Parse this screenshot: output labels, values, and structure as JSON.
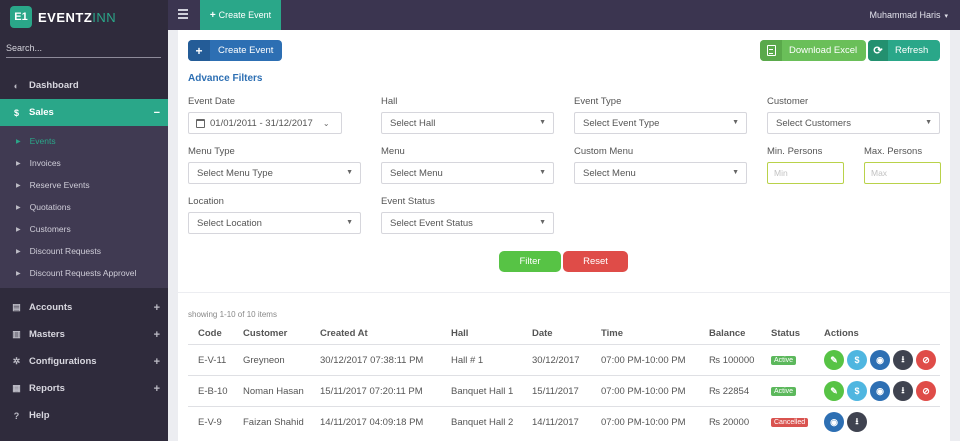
{
  "app": {
    "logo_mark": "E1",
    "logo_name_main": "EVENTZ",
    "logo_name_accent": "INN"
  },
  "topbar": {
    "create_label": "Create Event",
    "user_name": "Muhammad Haris"
  },
  "sidebar": {
    "search_placeholder": "Search...",
    "items": [
      {
        "label": "Dashboard",
        "icon": "dashboard-icon"
      },
      {
        "label": "Sales",
        "icon": "dollar-icon",
        "toggle": "−"
      },
      {
        "label": "Accounts",
        "icon": "folder-icon",
        "toggle": "+"
      },
      {
        "label": "Masters",
        "icon": "book-icon",
        "toggle": "+"
      },
      {
        "label": "Configurations",
        "icon": "gear-icon",
        "toggle": "+"
      },
      {
        "label": "Reports",
        "icon": "report-icon",
        "toggle": "+"
      },
      {
        "label": "Help",
        "icon": "question-icon"
      }
    ],
    "sales_sub": [
      "Events",
      "Invoices",
      "Reserve Events",
      "Quotations",
      "Customers",
      "Discount Requests",
      "Discount Requests Approvel"
    ]
  },
  "toolbar": {
    "create_label": "Create Event",
    "excel_label": "Download Excel",
    "refresh_label": "Refresh"
  },
  "filters": {
    "title": "Advance Filters",
    "event_date_label": "Event Date",
    "event_date_value": "01/01/2011 - 31/12/2017",
    "hall_label": "Hall",
    "hall_value": "Select Hall",
    "event_type_label": "Event Type",
    "event_type_value": "Select Event Type",
    "customer_label": "Customer",
    "customer_value": "Select Customers",
    "menu_type_label": "Menu Type",
    "menu_type_value": "Select Menu Type",
    "menu_label": "Menu",
    "menu_value": "Select Menu",
    "custom_menu_label": "Custom Menu",
    "custom_menu_value": "Select Menu",
    "min_persons_label": "Min. Persons",
    "min_persons_placeholder": "Min",
    "max_persons_label": "Max. Persons",
    "max_persons_placeholder": "Max",
    "location_label": "Location",
    "location_value": "Select Location",
    "event_status_label": "Event Status",
    "event_status_value": "Select Event Status",
    "filter_label": "Filter",
    "reset_label": "Reset"
  },
  "table": {
    "summary": "showing 1-10 of 10 items",
    "headers": [
      "Code",
      "Customer",
      "Created At",
      "Hall",
      "Date",
      "Time",
      "Balance",
      "Status",
      "Actions"
    ],
    "rows": [
      {
        "code": "E-V-11",
        "customer": "Greyneon",
        "created": "30/12/2017 07:38:11 PM",
        "hall": "Hall # 1",
        "date": "30/12/2017",
        "time": "07:00 PM-10:00 PM",
        "balance": "₨ 100000",
        "status": "Active",
        "status_color": "#5cb85c"
      },
      {
        "code": "E-B-10",
        "customer": "Noman Hasan",
        "created": "15/11/2017 07:20:11 PM",
        "hall": "Banquet Hall 1",
        "date": "15/11/2017",
        "time": "07:00 PM-10:00 PM",
        "balance": "₨ 22854",
        "status": "Active",
        "status_color": "#5cb85c"
      },
      {
        "code": "E-V-9",
        "customer": "Faizan Shahid",
        "created": "14/11/2017 04:09:18 PM",
        "hall": "Banquet Hall 2",
        "date": "14/11/2017",
        "time": "07:00 PM-10:00 PM",
        "balance": "₨ 20000",
        "status": "Cancelled",
        "status_color": "#d9534f"
      }
    ]
  },
  "colors": {
    "accent": "#2aa789",
    "sidebar": "#2f2b3c",
    "topbar": "#3b3550",
    "primary": "#2d6fb3"
  }
}
